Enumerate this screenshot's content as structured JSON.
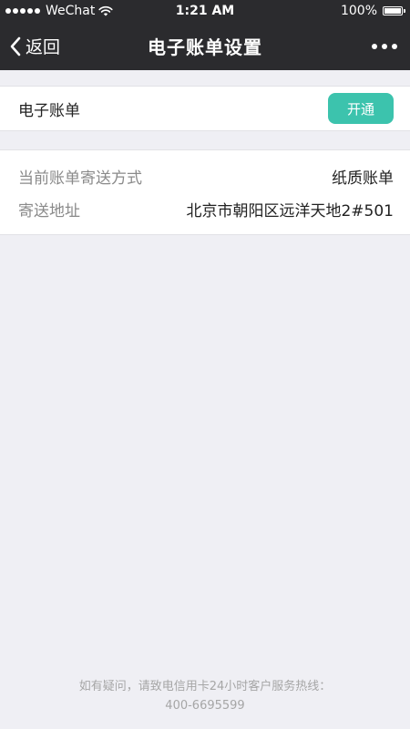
{
  "status_bar": {
    "carrier": "WeChat",
    "time": "1:21 AM",
    "battery": "100%",
    "icons": [
      "signal-dots-icon",
      "wifi-icon",
      "battery-icon"
    ]
  },
  "nav": {
    "back_label": "返回",
    "title": "电子账单设置",
    "back_icon": "chevron-left-icon",
    "more_icon": "more-dots-icon"
  },
  "ebill": {
    "label": "电子账单",
    "button_label": "开通"
  },
  "delivery": {
    "method_label": "当前账单寄送方式",
    "method_value": "纸质账单",
    "address_label": "寄送地址",
    "address_value": "北京市朝阳区远洋天地2#501"
  },
  "footer": {
    "line1": "如有疑问，请致电信用卡24小时客户服务热线：",
    "line2": "400-6695599"
  },
  "colors": {
    "nav_background": "#2b2b2e",
    "accent": "#3cc3ad",
    "page_background": "#efeff4"
  }
}
